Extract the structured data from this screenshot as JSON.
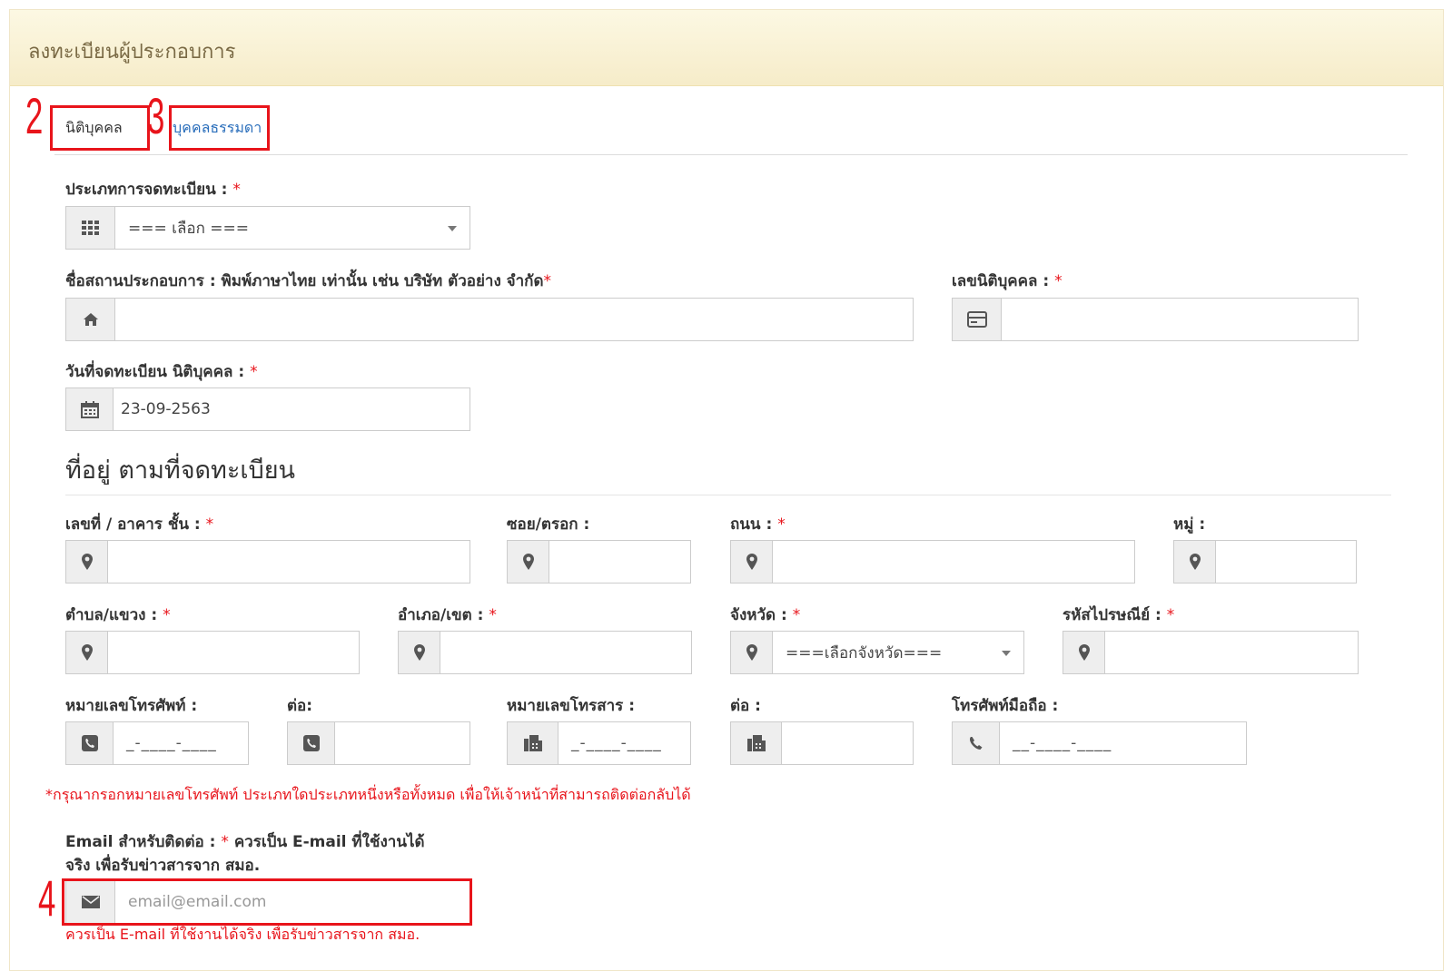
{
  "panel": {
    "title": "ลงทะเบียนผู้ประกอบการ"
  },
  "annotations": {
    "n2": "2",
    "n3": "3",
    "n4": "4"
  },
  "tabs": [
    {
      "label": "นิติบุคคล",
      "active": true
    },
    {
      "label": "บุคคลธรรมดา",
      "active": false
    }
  ],
  "form": {
    "reg_type": {
      "label": "ประเภทการจดทะเบียน :",
      "required": "*",
      "value": "=== เลือก ===",
      "icon": "grid-icon"
    },
    "business_name": {
      "label": "ชื่อสถานประกอบการ : พิมพ์ภาษาไทย เท่านั้น เช่น บริษัท ตัวอย่าง จำกัด",
      "required": "*",
      "value": "",
      "icon": "home-icon"
    },
    "juristic_id": {
      "label": "เลขนิติบุคคล :",
      "required": "*",
      "value": "",
      "icon": "id-card-icon"
    },
    "reg_date": {
      "label": "วันที่จดทะเบียน นิติบุคคล :",
      "required": "*",
      "value": "23-09-2563",
      "icon": "calendar-icon"
    },
    "address_section": "ที่อยู่ ตามที่จดทะเบียน",
    "house_no": {
      "label": "เลขที่ / อาคาร ชั้น :",
      "required": "*",
      "value": "",
      "icon": "map-marker-icon"
    },
    "soi": {
      "label": "ซอย/ตรอก :",
      "value": "",
      "icon": "map-marker-icon"
    },
    "road": {
      "label": "ถนน :",
      "required": "*",
      "value": "",
      "icon": "map-marker-icon"
    },
    "moo": {
      "label": "หมู่ :",
      "value": "",
      "icon": "map-marker-icon"
    },
    "subdistrict": {
      "label": "ตำบล/แขวง :",
      "required": "*",
      "value": "",
      "icon": "map-marker-icon"
    },
    "district": {
      "label": "อำเภอ/เขต :",
      "required": "*",
      "value": "",
      "icon": "map-marker-icon"
    },
    "province": {
      "label": "จังหวัด :",
      "required": "*",
      "value": "===เลือกจังหวัด===",
      "icon": "map-marker-icon"
    },
    "postcode": {
      "label": "รหัสไปรษณีย์ :",
      "required": "*",
      "value": "",
      "icon": "map-marker-icon"
    },
    "phone": {
      "label": "หมายเลขโทรศัพท์ :",
      "mask": "_-____-____",
      "icon": "phone-square-icon"
    },
    "phone_ext": {
      "label": "ต่อ:",
      "value": "",
      "icon": "phone-square-icon"
    },
    "fax": {
      "label": "หมายเลขโทรสาร :",
      "mask": "_-____-____",
      "icon": "fax-icon"
    },
    "fax_ext": {
      "label": "ต่อ :",
      "value": "",
      "icon": "fax-icon"
    },
    "mobile": {
      "label": "โทรศัพท์มือถือ :",
      "mask": "__-____-____",
      "icon": "phone-icon"
    },
    "phone_note": "*กรุณากรอกหมายเลขโทรศัพท์ ประเภทใดประเภทหนึ่งหรือทั้งหมด เพื่อให้เจ้าหน้าที่สามารถติดต่อกลับได้",
    "email": {
      "label_line1": "Email สำหรับติดต่อ :",
      "required": "*",
      "label_note": "ควรเป็น E-mail ที่ใช้งานได้",
      "label_line2": "จริง เพื่อรับข่าวสารจาก สมอ.",
      "placeholder": "email@email.com",
      "icon": "envelope-icon",
      "help": "ควรเป็น E-mail ที่ใช้งานได้จริง เพื่อรับข่าวสารจาก สมอ."
    }
  }
}
